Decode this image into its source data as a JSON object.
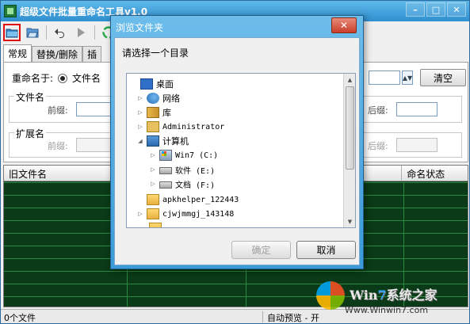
{
  "main_window": {
    "title": "超级文件批量重命名工具v1.0",
    "window_buttons": [
      "–",
      "□",
      "✕"
    ]
  },
  "toolbar": {
    "icons": [
      "open-folder-icon",
      "open-file-icon",
      "undo-icon",
      "play-icon",
      "recycle-icon"
    ]
  },
  "tabs": [
    {
      "label": "常规",
      "active": true
    },
    {
      "label": "替换/删除",
      "active": false
    },
    {
      "label": "插",
      "active": false
    }
  ],
  "settings": {
    "rename_label": "重命名于:",
    "rename_option": "文件名",
    "filename_group": "文件名",
    "filename_prefix_label": "前缀:",
    "filename_suffix_label": "后缀:",
    "ext_group": "扩展名",
    "ext_prefix_label": "前缀:",
    "ext_suffix_label": "后缀:",
    "clear_button": "清空"
  },
  "file_list": {
    "columns": [
      "旧文件名",
      "命名状态"
    ]
  },
  "status_bar": {
    "file_count": "0个文件",
    "preview": "自动预览 - 开"
  },
  "watermark": {
    "title_win": "Win",
    "title_7": "7",
    "title_rest": "系统之家",
    "url": "Www.Winwin7.com"
  },
  "dialog": {
    "title": "浏览文件夹",
    "close": "✕",
    "prompt": "请选择一个目录",
    "tree": [
      {
        "label": "桌面",
        "icon": "desktop-icon"
      },
      {
        "label": "网络",
        "icon": "network-icon"
      },
      {
        "label": "库",
        "icon": "library-icon"
      },
      {
        "label": "Administrator",
        "icon": "user-folder-icon"
      },
      {
        "label": "计算机",
        "icon": "computer-icon"
      },
      {
        "label": "Win7 (C:)",
        "icon": "system-drive-icon"
      },
      {
        "label": "软件 (E:)",
        "icon": "drive-icon"
      },
      {
        "label": "文档 (F:)",
        "icon": "drive-icon"
      },
      {
        "label": "apkhelper_122443",
        "icon": "folder-icon"
      },
      {
        "label": "cjwjmmgj_143148",
        "icon": "folder-icon"
      }
    ],
    "ok_button": "确定",
    "cancel_button": "取消"
  }
}
